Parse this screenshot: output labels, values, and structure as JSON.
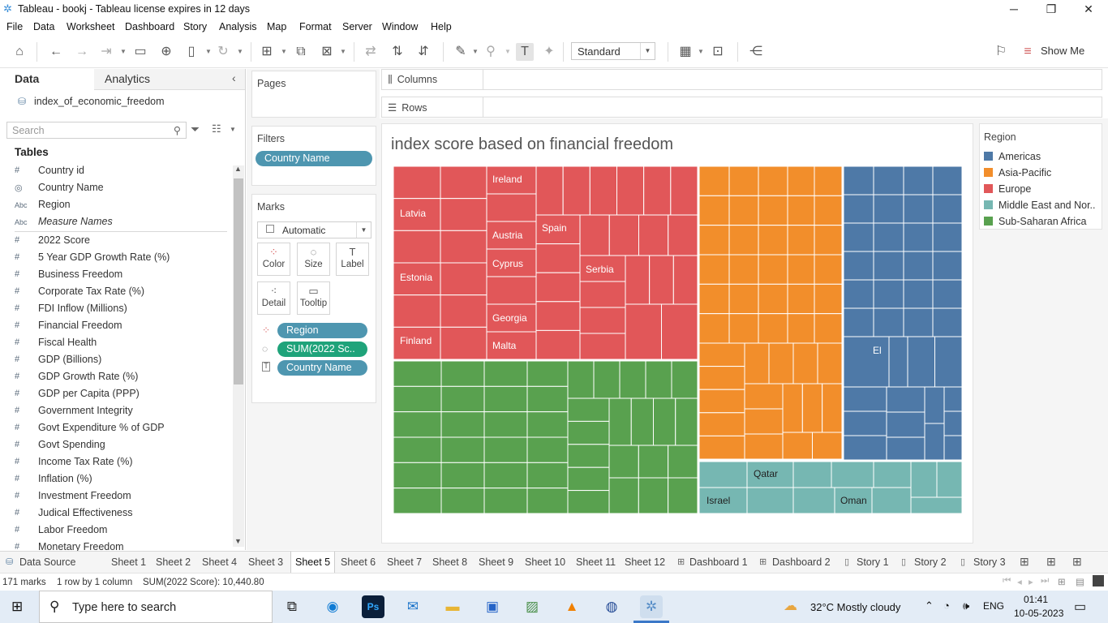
{
  "window": {
    "title": "Tableau - bookj - Tableau license expires in 12 days"
  },
  "menu": [
    "File",
    "Data",
    "Worksheet",
    "Dashboard",
    "Story",
    "Analysis",
    "Map",
    "Format",
    "Server",
    "Window",
    "Help"
  ],
  "toolbar": {
    "fit_select": "Standard",
    "show_me": "Show Me"
  },
  "data_pane": {
    "tab_data": "Data",
    "tab_analytics": "Analytics",
    "datasource": "index_of_economic_freedom",
    "search_placeholder": "Search",
    "tables_label": "Tables",
    "dimensions": [
      {
        "icon": "#",
        "name": "Country id"
      },
      {
        "icon": "◎",
        "name": "Country Name"
      },
      {
        "icon": "Abc",
        "name": "Region"
      },
      {
        "icon": "Abc",
        "name": "Measure Names"
      }
    ],
    "measures": [
      {
        "icon": "#",
        "name": "2022 Score"
      },
      {
        "icon": "#",
        "name": "5 Year GDP Growth Rate (%)"
      },
      {
        "icon": "#",
        "name": "Business Freedom"
      },
      {
        "icon": "#",
        "name": "Corporate Tax Rate (%)"
      },
      {
        "icon": "#",
        "name": "FDI Inflow (Millions)"
      },
      {
        "icon": "#",
        "name": "Financial Freedom"
      },
      {
        "icon": "#",
        "name": "Fiscal Health"
      },
      {
        "icon": "#",
        "name": "GDP (Billions)"
      },
      {
        "icon": "#",
        "name": "GDP Growth Rate (%)"
      },
      {
        "icon": "#",
        "name": "GDP per Capita (PPP)"
      },
      {
        "icon": "#",
        "name": "Government Integrity"
      },
      {
        "icon": "#",
        "name": "Govt Expenditure % of GDP"
      },
      {
        "icon": "#",
        "name": "Govt Spending"
      },
      {
        "icon": "#",
        "name": "Income Tax Rate (%)"
      },
      {
        "icon": "#",
        "name": "Inflation (%)"
      },
      {
        "icon": "#",
        "name": "Investment Freedom"
      },
      {
        "icon": "#",
        "name": "Judical Effectiveness"
      },
      {
        "icon": "#",
        "name": "Labor Freedom"
      },
      {
        "icon": "#",
        "name": "Monetary Freedom"
      }
    ]
  },
  "pages": {
    "label": "Pages"
  },
  "filters": {
    "label": "Filters",
    "pill": "Country Name"
  },
  "marks": {
    "label": "Marks",
    "type": "Automatic",
    "buttons": [
      "Color",
      "Size",
      "Label",
      "Detail",
      "Tooltip"
    ],
    "pills": [
      "Region",
      "SUM(2022 Sc..",
      "Country Name"
    ]
  },
  "shelves": {
    "columns": "Columns",
    "rows": "Rows"
  },
  "viz": {
    "title": "index score based on financial freedom",
    "labels": [
      "Latvia",
      "Ireland",
      "Spain",
      "Austria",
      "Estonia",
      "Serbia",
      "Cyprus",
      "Georgia",
      "Finland",
      "Malta",
      "El",
      "Qatar",
      "Israel",
      "Oman"
    ]
  },
  "legend": {
    "title": "Region",
    "items": [
      {
        "name": "Americas",
        "color": "#4e79a7"
      },
      {
        "name": "Asia-Pacific",
        "color": "#f28e2b"
      },
      {
        "name": "Europe",
        "color": "#e15759"
      },
      {
        "name": "Middle East and Nor..",
        "color": "#76b7b2"
      },
      {
        "name": "Sub-Saharan Africa",
        "color": "#59a14f"
      }
    ]
  },
  "sheet_tabs": [
    "Data Source",
    "Sheet 1",
    "Sheet 2",
    "Sheet 4",
    "Sheet 3",
    "Sheet 5",
    "Sheet 6",
    "Sheet 7",
    "Sheet 8",
    "Sheet 9",
    "Sheet 10",
    "Sheet 11",
    "Sheet 12",
    "Dashboard 1",
    "Dashboard 2",
    "Story 1",
    "Story 2",
    "Story 3"
  ],
  "active_sheet": "Sheet 5",
  "status": {
    "marks": "171 marks",
    "rows_cols": "1 row by 1 column",
    "sum": "SUM(2022 Score): 10,440.80"
  },
  "taskbar": {
    "search_placeholder": "Type here to search",
    "weather": "32°C  Mostly cloudy",
    "lang": "ENG",
    "time": "01:41",
    "date": "10-05-2023"
  }
}
